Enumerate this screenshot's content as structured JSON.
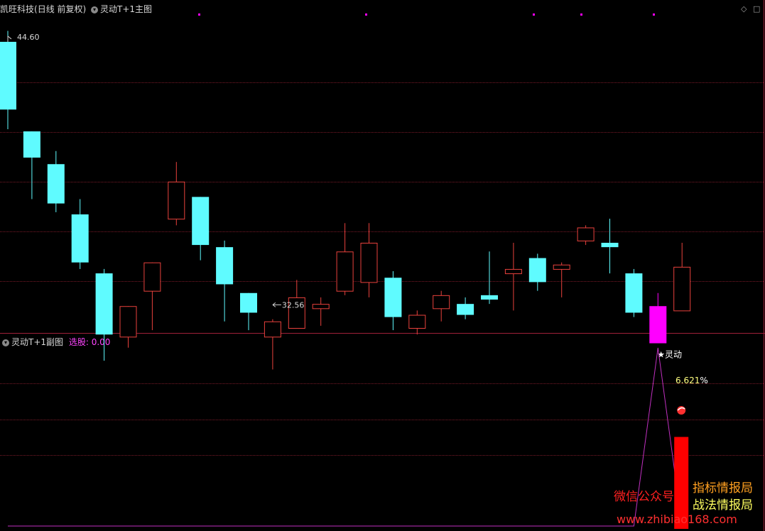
{
  "main_panel": {
    "stock_name": "凯旺科技",
    "stock_mode": "(日线 前复权)",
    "indicator_title": "灵动T+1主图",
    "high_label": "44.60",
    "low_label": "32.56",
    "signal_label": "★灵动"
  },
  "sub_panel": {
    "title": "灵动T+1副图",
    "select_label": "选股: 0.00",
    "percent_label": "6.621",
    "percent_sign": "%"
  },
  "window_controls": {
    "restore": "◇",
    "close": "□"
  },
  "watermark": {
    "line1_left": "微信公众号",
    "line1_right": "指标情报局",
    "line2_right": "战法情报局",
    "url": "www.zhibiao168.com"
  },
  "colors": {
    "background": "#000000",
    "up_candle": "#e8413c",
    "down_candle": "#5ffbff",
    "signal_candle": "#ff00ff",
    "grid": "#7a1a28",
    "sub_line": "#c030c0",
    "sub_bar": "#ff0000",
    "percent_text": "#ffff80"
  },
  "chart_data": [
    {
      "type": "candlestick",
      "title": "灵动T+1主图",
      "price_range": [
        31.5,
        45.8
      ],
      "high_marker": 44.6,
      "low_marker": 32.56,
      "candles": [
        {
          "open": 44.6,
          "high": 45.1,
          "low": 40.6,
          "close": 41.5,
          "dir": "down"
        },
        {
          "open": 40.5,
          "high": 40.5,
          "low": 37.4,
          "close": 39.3,
          "dir": "down"
        },
        {
          "open": 39.0,
          "high": 39.6,
          "low": 36.8,
          "close": 37.2,
          "dir": "down"
        },
        {
          "open": 36.7,
          "high": 37.4,
          "low": 34.2,
          "close": 34.5,
          "dir": "down"
        },
        {
          "open": 34.0,
          "high": 34.2,
          "low": 30.0,
          "close": 31.2,
          "dir": "down"
        },
        {
          "open": 32.5,
          "high": 32.5,
          "low": 30.6,
          "close": 31.1,
          "dir": "up"
        },
        {
          "open": 33.2,
          "high": 33.2,
          "low": 31.4,
          "close": 34.5,
          "dir": "up"
        },
        {
          "open": 36.5,
          "high": 39.1,
          "low": 36.2,
          "close": 38.2,
          "dir": "up"
        },
        {
          "open": 37.5,
          "high": 36.9,
          "low": 34.6,
          "close": 35.3,
          "dir": "down"
        },
        {
          "open": 35.2,
          "high": 35.5,
          "low": 31.8,
          "close": 33.5,
          "dir": "down"
        },
        {
          "open": 33.1,
          "high": 33.1,
          "low": 31.4,
          "close": 32.2,
          "dir": "down"
        },
        {
          "open": 31.8,
          "high": 31.9,
          "low": 29.6,
          "close": 31.1,
          "dir": "up"
        },
        {
          "open": 31.5,
          "high": 33.7,
          "low": 31.5,
          "close": 32.9,
          "dir": "up"
        },
        {
          "open": 32.4,
          "high": 32.9,
          "low": 31.6,
          "close": 32.6,
          "dir": "up"
        },
        {
          "open": 33.2,
          "high": 36.3,
          "low": 33.0,
          "close": 35.0,
          "dir": "up"
        },
        {
          "open": 33.6,
          "high": 36.3,
          "low": 32.9,
          "close": 35.4,
          "dir": "up"
        },
        {
          "open": 33.8,
          "high": 34.1,
          "low": 31.4,
          "close": 32.0,
          "dir": "down"
        },
        {
          "open": 31.5,
          "high": 32.3,
          "low": 31.2,
          "close": 32.1,
          "dir": "up"
        },
        {
          "open": 32.4,
          "high": 33.2,
          "low": 31.8,
          "close": 33.0,
          "dir": "up"
        },
        {
          "open": 32.6,
          "high": 32.9,
          "low": 31.9,
          "close": 32.1,
          "dir": "down"
        },
        {
          "open": 33.0,
          "high": 35.0,
          "low": 32.6,
          "close": 32.8,
          "dir": "down"
        },
        {
          "open": 34.0,
          "high": 35.4,
          "low": 32.3,
          "close": 34.2,
          "dir": "up"
        },
        {
          "open": 34.7,
          "high": 34.9,
          "low": 33.2,
          "close": 33.6,
          "dir": "down"
        },
        {
          "open": 34.2,
          "high": 34.5,
          "low": 32.9,
          "close": 34.4,
          "dir": "up"
        },
        {
          "open": 35.5,
          "high": 36.2,
          "low": 35.3,
          "close": 36.1,
          "dir": "up"
        },
        {
          "open": 35.4,
          "high": 36.5,
          "low": 34.0,
          "close": 35.2,
          "dir": "down"
        },
        {
          "open": 34.0,
          "high": 34.2,
          "low": 32.0,
          "close": 32.2,
          "dir": "down"
        },
        {
          "open": 32.5,
          "high": 33.1,
          "low": 31.3,
          "close": 30.8,
          "dir": "signal"
        },
        {
          "open": 32.3,
          "high": 35.4,
          "low": 32.3,
          "close": 34.3,
          "dir": "up"
        }
      ]
    },
    {
      "type": "line",
      "title": "灵动T+1副图",
      "series": [
        {
          "values": [
            0,
            0,
            0,
            0,
            0,
            0,
            0,
            0,
            0,
            0,
            0,
            0,
            0,
            0,
            0,
            0,
            0,
            0,
            0,
            0,
            0,
            0,
            0,
            0,
            0,
            0,
            0,
            1,
            0
          ]
        }
      ],
      "bar_value": 0.5,
      "label": "6.621%"
    }
  ]
}
